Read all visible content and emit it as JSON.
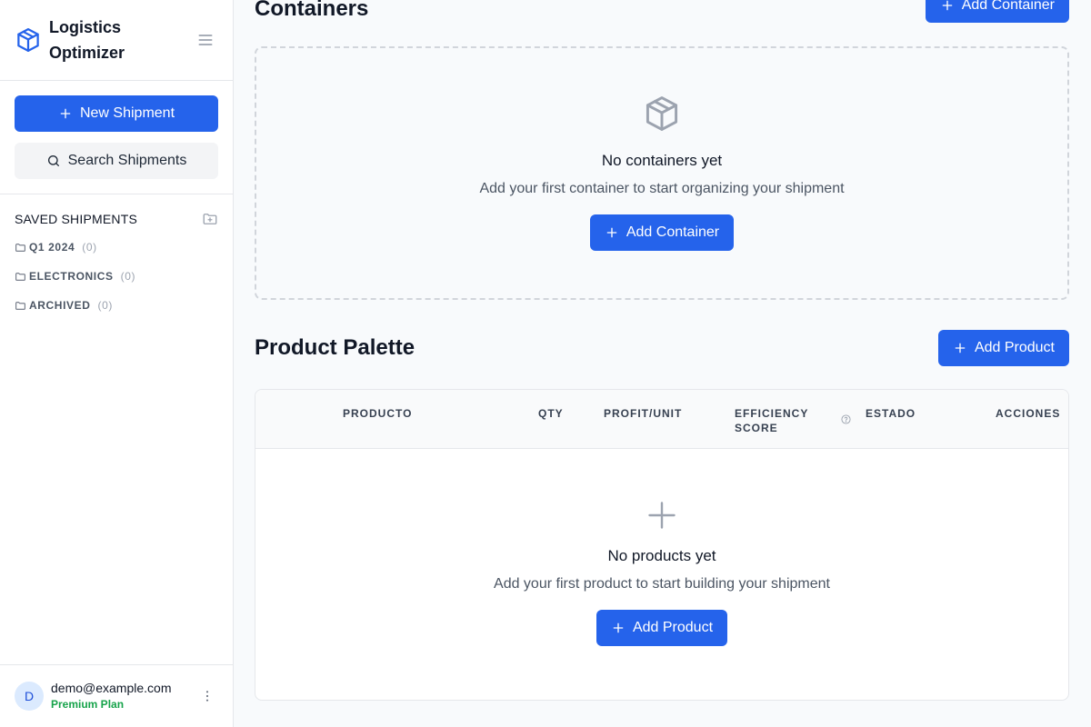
{
  "sidebar": {
    "brand": "Logistics Optimizer",
    "new_shipment": "New Shipment",
    "search_shipments": "Search Shipments",
    "saved_title": "SAVED SHIPMENTS",
    "folders": [
      {
        "name": "Q1 2024",
        "count": "(0)"
      },
      {
        "name": "ELECTRONICS",
        "count": "(0)"
      },
      {
        "name": "ARCHIVED",
        "count": "(0)"
      }
    ],
    "user": {
      "initial": "D",
      "email": "demo@example.com",
      "plan": "Premium Plan"
    }
  },
  "containers": {
    "title": "Containers",
    "add_label": "Add Container",
    "empty_title": "No containers yet",
    "empty_sub": "Add your first container to start organizing your shipment",
    "empty_button": "Add Container"
  },
  "products": {
    "title": "Product Palette",
    "add_label": "Add Product",
    "columns": {
      "product": "PRODUCTO",
      "qty": "QTY",
      "profit": "PROFIT/UNIT",
      "efficiency_1": "EFFICIENCY",
      "efficiency_2": "SCORE",
      "status": "ESTADO",
      "actions": "ACCIONES"
    },
    "empty_title": "No products yet",
    "empty_sub": "Add your first product to start building your shipment",
    "empty_button": "Add Product"
  },
  "colors": {
    "accent": "#2563eb",
    "plan": "#16a34a"
  },
  "icons": {
    "brand": "package-icon",
    "menu": "menu-icon",
    "search": "search-icon",
    "folder_add": "folder-plus-icon",
    "folder": "folder-icon",
    "kebab": "more-vertical-icon",
    "help": "help-circle-icon"
  }
}
